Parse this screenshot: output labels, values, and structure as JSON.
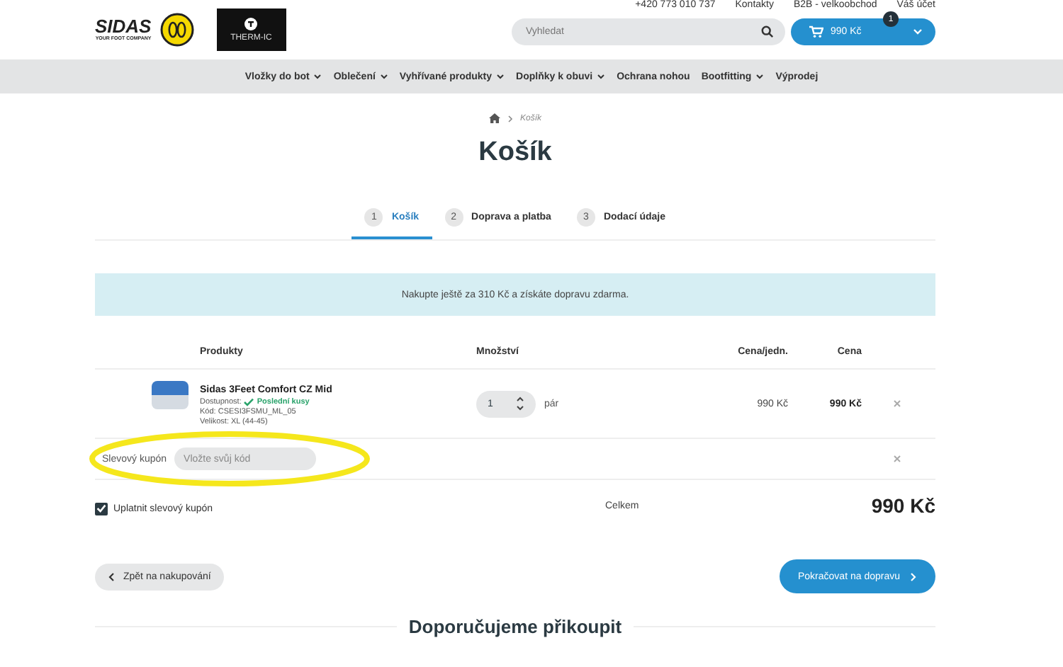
{
  "topbar": {
    "phone": "+420 773 010 737",
    "links": [
      "Kontakty",
      "B2B - velkoobchod",
      "Váš účet"
    ]
  },
  "header": {
    "logo": "SIDAS",
    "logo_tagline": "YOUR FOOT COMPANY",
    "second_logo": "THERM-IC",
    "search": {
      "placeholder": "Vyhledat"
    },
    "cart": {
      "total": "990 Kč",
      "count": "1"
    }
  },
  "nav": [
    {
      "label": "Vložky do bot",
      "dropdown": true
    },
    {
      "label": "Oblečení",
      "dropdown": true
    },
    {
      "label": "Vyhřívané produkty",
      "dropdown": true
    },
    {
      "label": "Doplňky k obuvi",
      "dropdown": true
    },
    {
      "label": "Ochrana nohou",
      "dropdown": false
    },
    {
      "label": "Bootfitting",
      "dropdown": true
    },
    {
      "label": "Výprodej",
      "dropdown": false
    }
  ],
  "breadcrumb": [
    "Košík"
  ],
  "title": "Košík",
  "steps": [
    {
      "number": "1",
      "label": "Košík",
      "selected": true
    },
    {
      "number": "2",
      "label": "Doprava a platba",
      "selected": false
    },
    {
      "number": "3",
      "label": "Dodací údaje",
      "selected": false
    }
  ],
  "notice": "Nakupte ještě za 310 Kč a získáte dopravu zdarma.",
  "table": {
    "columns": [
      "Produkty",
      "Množství",
      "Cena/jedn.",
      "Cena"
    ],
    "rows": [
      {
        "name": "Sidas 3Feet Comfort CZ Mid",
        "availability_label": "Dostupnost:",
        "availability": "Poslední kusy",
        "code": "Kód: CSESI3FSMU_ML_05",
        "size": "Velikost: XL (44-45)",
        "quantity": "1",
        "unit": "pár",
        "unit_price": "990 Kč",
        "price": "990 Kč"
      }
    ]
  },
  "coupon": {
    "label": "Slevový kupón",
    "placeholder": "Vložte svůj kód"
  },
  "apply_coupon": {
    "label": "Uplatnit slevový kupón",
    "checked": true
  },
  "total": {
    "label": "Celkem",
    "value": "990 Kč"
  },
  "back_button": "Zpět na nakupování",
  "continue_button": "Pokračovat na dopravu",
  "recommend_heading": "Doporučujeme přikoupit"
}
